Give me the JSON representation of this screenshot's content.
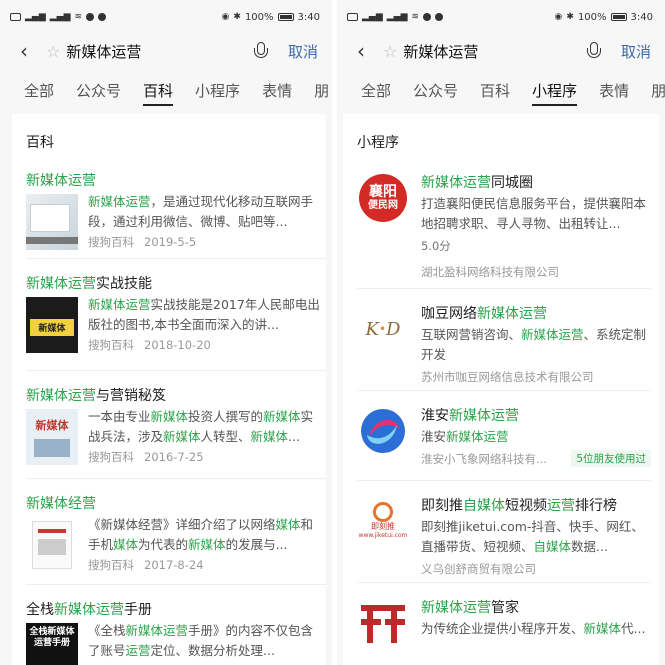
{
  "status_bar": {
    "battery": "100%",
    "time": "3:40"
  },
  "search": {
    "query": "新媒体运营",
    "cancel_label": "取消"
  },
  "tabs": [
    "全部",
    "公众号",
    "百科",
    "小程序",
    "表情",
    "朋"
  ],
  "left": {
    "active_tab": "百科",
    "section_title": "百科",
    "items": [
      {
        "title_parts": [
          [
            "新媒体运营",
            true
          ]
        ],
        "desc_parts": [
          [
            "新媒体运营",
            true
          ],
          [
            "，是通过现代化移动互联网手段，通过利用微信、微博、贴吧等...",
            false
          ]
        ],
        "source": "搜狗百科",
        "date": "2019-5-5",
        "thumb": "book-screen"
      },
      {
        "title_parts": [
          [
            "新媒体运营",
            true
          ],
          [
            "实战技能",
            false
          ]
        ],
        "desc_parts": [
          [
            "新媒体运营",
            true
          ],
          [
            "实战技能是2017年人民邮电出版社的图书,本书全面而深入的讲...",
            false
          ]
        ],
        "source": "搜狗百科",
        "date": "2018-10-20",
        "thumb": "book-dark",
        "thumb_text": "新媒体"
      },
      {
        "title_parts": [
          [
            "新媒体运营",
            true
          ],
          [
            "与营销秘笈",
            false
          ]
        ],
        "desc_parts": [
          [
            "一本由专业",
            false
          ],
          [
            "新媒体",
            true
          ],
          [
            "投资人撰写的",
            false
          ],
          [
            "新媒体",
            true
          ],
          [
            "实战兵法，涉及",
            false
          ],
          [
            "新媒体",
            true
          ],
          [
            "人转型、",
            false
          ],
          [
            "新媒体",
            true
          ],
          [
            "...",
            false
          ]
        ],
        "source": "搜狗百科",
        "date": "2016-7-25",
        "thumb": "book-light",
        "thumb_text": "新媒体"
      },
      {
        "title_parts": [
          [
            "新媒体经营",
            true
          ]
        ],
        "desc_parts": [
          [
            "《新媒体经营》详细介绍了以网络",
            false
          ],
          [
            "媒体",
            true
          ],
          [
            "和手机",
            false
          ],
          [
            "媒体",
            true
          ],
          [
            "为代表的",
            false
          ],
          [
            "新媒体",
            true
          ],
          [
            "的发展与...",
            false
          ]
        ],
        "source": "搜狗百科",
        "date": "2017-8-24",
        "thumb": "book-white"
      },
      {
        "title_parts": [
          [
            "全栈",
            false
          ],
          [
            "新媒体运营",
            true
          ],
          [
            "手册",
            false
          ]
        ],
        "desc_parts": [
          [
            "《全栈",
            false
          ],
          [
            "新媒体运营",
            true
          ],
          [
            "手册》的内容不仅包含了账号",
            false
          ],
          [
            "运营",
            true
          ],
          [
            "定位、数据分析处理...",
            false
          ]
        ],
        "thumb": "book-black",
        "thumb_text": "全栈新媒体运营手册"
      }
    ]
  },
  "right": {
    "active_tab": "小程序",
    "section_title": "小程序",
    "items": [
      {
        "title_parts": [
          [
            "新媒体运营",
            true
          ],
          [
            "同城圈",
            false
          ]
        ],
        "desc_parts": [
          [
            "打造襄阳便民信息服务平台，提供襄阳本地招聘求职、寻人寻物、出租转让...",
            false
          ]
        ],
        "rating": "5.0分",
        "company": "湖北盈科网络科技有限公司",
        "logo": "xiangyang",
        "logo_text": [
          "襄阳",
          "便民网"
        ]
      },
      {
        "title_parts": [
          [
            "咖豆网络",
            false
          ],
          [
            "新媒体运营",
            true
          ]
        ],
        "desc_parts": [
          [
            "互联网营销咨询、",
            false
          ],
          [
            "新媒体运营",
            true
          ],
          [
            "、系统定制开发",
            false
          ]
        ],
        "company": "苏州市咖豆网络信息技术有限公司",
        "logo": "kd",
        "logo_text": [
          "K",
          "D"
        ]
      },
      {
        "title_parts": [
          [
            "淮安",
            false
          ],
          [
            "新媒体运营",
            true
          ]
        ],
        "desc_parts": [
          [
            "淮安",
            false
          ],
          [
            "新媒体运营",
            true
          ]
        ],
        "company": "淮安小飞象网络科技有...",
        "friends": "5位朋友使用过",
        "logo": "swirl"
      },
      {
        "title_parts": [
          [
            "即刻推",
            false
          ],
          [
            "自媒体",
            true
          ],
          [
            "短视频",
            false
          ],
          [
            "运营",
            true
          ],
          [
            "排行榜",
            false
          ]
        ],
        "desc_parts": [
          [
            "即刻推jiketui.com-抖音、快手、网红、直播带货、短视频、",
            false
          ],
          [
            "自媒体",
            true
          ],
          [
            "数据...",
            false
          ]
        ],
        "company": "义乌创舒商贸有限公司",
        "logo": "jike",
        "logo_text": [
          "即刻推",
          "www.jiketui.com"
        ]
      },
      {
        "title_parts": [
          [
            "新媒体运营",
            true
          ],
          [
            "管家",
            false
          ]
        ],
        "desc_parts": [
          [
            "为传统企业提供小程序开发、",
            false
          ],
          [
            "新媒体",
            true
          ],
          [
            "代...",
            false
          ]
        ],
        "logo": "sf"
      }
    ]
  },
  "colors": {
    "highlight": "#2aa34a",
    "cancel": "#3d6aa8",
    "meta": "#999999"
  }
}
